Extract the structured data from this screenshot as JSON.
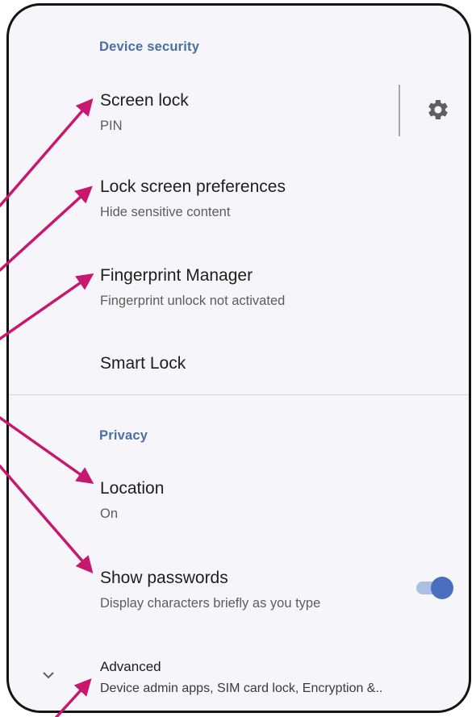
{
  "sections": {
    "device_security": {
      "header": "Device security",
      "items": [
        {
          "title": "Screen lock",
          "summary": "PIN"
        },
        {
          "title": "Lock screen preferences",
          "summary": "Hide sensitive content"
        },
        {
          "title": "Fingerprint Manager",
          "summary": "Fingerprint unlock not activated"
        },
        {
          "title": "Smart Lock"
        }
      ]
    },
    "privacy": {
      "header": "Privacy",
      "items": [
        {
          "title": "Location",
          "summary": "On"
        },
        {
          "title": "Show passwords",
          "summary": "Display characters briefly as you type",
          "toggle_on": true
        }
      ]
    },
    "advanced": {
      "title": "Advanced",
      "summary": "Device admin apps, SIM card lock, Encryption &.."
    }
  },
  "colors": {
    "accent": "#4b6fa5",
    "toggle_thumb": "#4a6fbf",
    "toggle_track": "#a9bfe3",
    "annotation_arrow": "#c8176e",
    "background": "#f6f5f9"
  },
  "icons": {
    "screen_lock_settings": "gear-icon",
    "advanced_expand": "chevron-down-icon"
  }
}
